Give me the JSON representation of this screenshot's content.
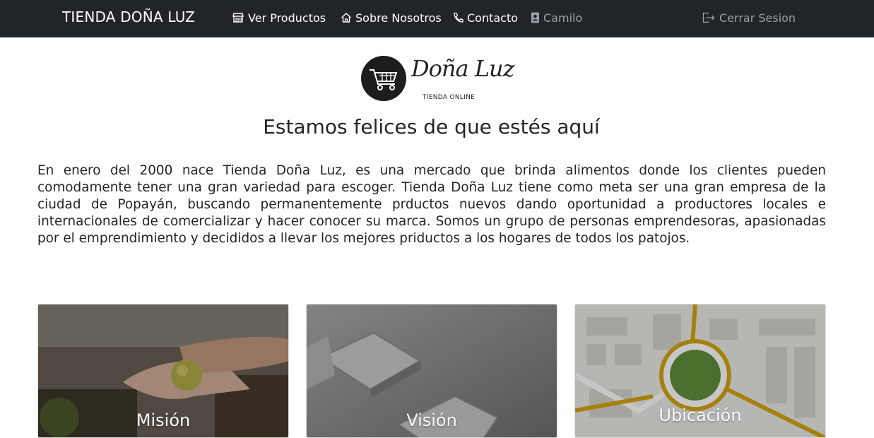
{
  "navbar": {
    "brand": "TIENDA DOÑA LUZ",
    "links": [
      {
        "label": "Ver Productos",
        "icon": "store-icon"
      },
      {
        "label": "Sobre Nosotros",
        "icon": "house-icon"
      },
      {
        "label": "Contacto",
        "icon": "phone-icon"
      },
      {
        "label": "Camilo",
        "icon": "user-badge-icon"
      }
    ],
    "logout": {
      "label": "Cerrar Sesion",
      "icon": "logout-icon"
    }
  },
  "logo": {
    "script_text": "Doña Luz",
    "subtitle": "TIENDA ONLINE",
    "icon": "shopping-cart-icon"
  },
  "main": {
    "heading": "Estamos felices de que estés aquí",
    "paragraph": "En enero del 2000 nace Tienda Doña Luz, es una mercado que brinda alimentos donde los clientes pueden comodamente tener una gran variedad para escoger. Tienda Doña Luz tiene como meta ser una gran empresa de la ciudad de Popayán, buscando permanentemente prductos nuevos dando oportunidad a productores locales e internacionales de comercializar y hacer conocer su marca. Somos un grupo de personas emprendesoras, apasionadas por el emprendimiento y decididos a llevar los mejores priductos a los hogares de todos los patojos."
  },
  "cards": [
    {
      "title": "Misión"
    },
    {
      "title": "Visión"
    },
    {
      "title": "Ubicación"
    }
  ],
  "colors": {
    "navbar_bg": "#212529",
    "text": "#212529",
    "muted_nav": "#9aa0a6",
    "map_road": "#d4a514",
    "map_green": "#5f8f3c"
  }
}
